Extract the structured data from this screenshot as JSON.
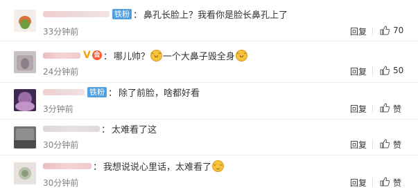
{
  "comments": [
    {
      "badge": "铁粉",
      "text": "鼻孔长脸上？我看你是脸长鼻孔上了",
      "time": "33分钟前",
      "reply": "回复",
      "like": "70"
    },
    {
      "text_a": "哪儿帅？",
      "text_b": "一个大鼻子毁全身",
      "time": "24分钟前",
      "reply": "回复",
      "like": "50",
      "emoji_icon": "grinning-sweat-emoji"
    },
    {
      "badge": "铁粉",
      "text": "除了前脸，啥都好看",
      "time": "3分钟前",
      "reply": "回复",
      "like": "赞"
    },
    {
      "text": "太难看了这",
      "time": "30分钟前",
      "reply": "回复",
      "like": "赞"
    },
    {
      "text": "我想说说心里话，太难看了",
      "time": "30分钟前",
      "reply": "回复",
      "like": "赞",
      "emoji_icon": "wry-smile-emoji"
    }
  ],
  "colors": {
    "badge_bg": "#4fa0e0",
    "time": "#808080",
    "text": "#333333"
  }
}
